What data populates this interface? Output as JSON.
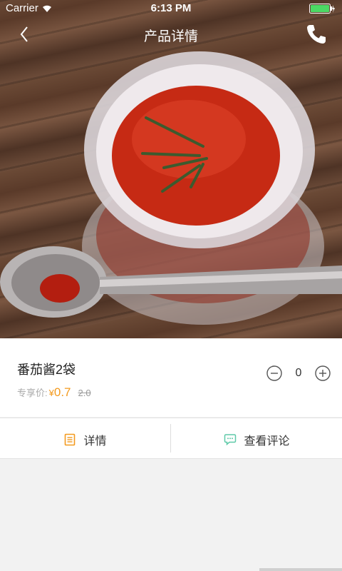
{
  "status_bar": {
    "carrier": "Carrier",
    "time": "6:13 PM",
    "battery_color": "#4cd964"
  },
  "nav": {
    "title": "产品详情",
    "back_icon": "chevron-left-icon",
    "phone_icon": "phone-icon"
  },
  "product": {
    "name": "番茄酱2袋",
    "price_label": "专享价:",
    "currency": "¥",
    "price": "0.7",
    "original_price": "2.0",
    "quantity": "0",
    "accent_color": "#f39a1e"
  },
  "tabs": [
    {
      "label": "详情",
      "icon": "document-icon",
      "icon_color": "#f39a1e"
    },
    {
      "label": "查看评论",
      "icon": "chat-bubble-icon",
      "icon_color": "#5ec9a8"
    }
  ]
}
